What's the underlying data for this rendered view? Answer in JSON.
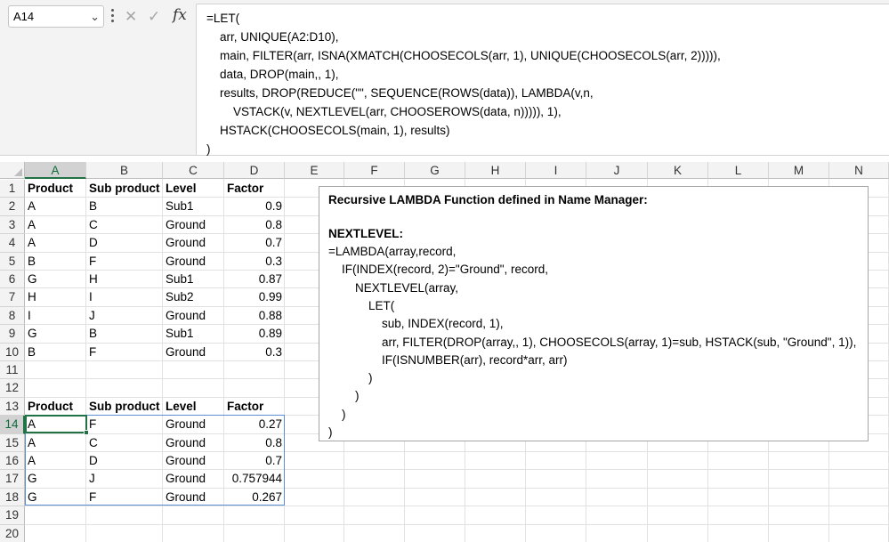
{
  "name_box": {
    "value": "A14"
  },
  "formula_bar": {
    "icons": [
      "cancel-icon",
      "enter-icon",
      "fx-icon"
    ],
    "fx_label": "fx",
    "lines": [
      "=LET(",
      "    arr, UNIQUE(A2:D10),",
      "    main, FILTER(arr, ISNA(XMATCH(CHOOSECOLS(arr, 1), UNIQUE(CHOOSECOLS(arr, 2))))),",
      "    data, DROP(main,, 1),",
      "    results, DROP(REDUCE(\"\", SEQUENCE(ROWS(data)), LAMBDA(v,n,",
      "        VSTACK(v, NEXTLEVEL(arr, CHOOSEROWS(data, n))))), 1),",
      "    HSTACK(CHOOSECOLS(main, 1), results)",
      ")"
    ]
  },
  "columns": [
    "A",
    "B",
    "C",
    "D",
    "E",
    "F",
    "G",
    "H",
    "I",
    "J",
    "K",
    "L",
    "M",
    "N"
  ],
  "selected_column": "A",
  "rows": [
    "1",
    "2",
    "3",
    "4",
    "5",
    "6",
    "7",
    "8",
    "9",
    "10",
    "11",
    "12",
    "13",
    "14",
    "15",
    "16",
    "17",
    "18",
    "19",
    "20"
  ],
  "selected_row": "14",
  "table1": {
    "headers": [
      "Product",
      "Sub product",
      "Level",
      "Factor"
    ],
    "rows": [
      [
        "A",
        "B",
        "Sub1",
        "0.9"
      ],
      [
        "A",
        "C",
        "Ground",
        "0.8"
      ],
      [
        "A",
        "D",
        "Ground",
        "0.7"
      ],
      [
        "B",
        "F",
        "Ground",
        "0.3"
      ],
      [
        "G",
        "H",
        "Sub1",
        "0.87"
      ],
      [
        "H",
        "I",
        "Sub2",
        "0.99"
      ],
      [
        "I",
        "J",
        "Ground",
        "0.88"
      ],
      [
        "G",
        "B",
        "Sub1",
        "0.89"
      ],
      [
        "B",
        "F",
        "Ground",
        "0.3"
      ]
    ]
  },
  "table2": {
    "headers": [
      "Product",
      "Sub product",
      "Level",
      "Factor"
    ],
    "rows": [
      [
        "A",
        "F",
        "Ground",
        "0.27"
      ],
      [
        "A",
        "C",
        "Ground",
        "0.8"
      ],
      [
        "A",
        "D",
        "Ground",
        "0.7"
      ],
      [
        "G",
        "J",
        "Ground",
        "0.757944"
      ],
      [
        "G",
        "F",
        "Ground",
        "0.267"
      ]
    ]
  },
  "textbox": {
    "title": "Recursive LAMBDA Function defined in Name Manager:",
    "name": "NEXTLEVEL:",
    "lines": [
      "=LAMBDA(array,record,",
      "    IF(INDEX(record, 2)=\"Ground\", record,",
      "        NEXTLEVEL(array,",
      "            LET(",
      "                sub, INDEX(record, 1),",
      "                arr, FILTER(DROP(array,, 1), CHOOSECOLS(array, 1)=sub, HSTACK(sub, \"Ground\", 1)),",
      "                IF(ISNUMBER(arr), record*arr, arr)",
      "            )",
      "        )",
      "    )",
      ")"
    ]
  },
  "colors": {
    "selection": "#217346",
    "spill_border": "#5b8fd6",
    "header_bg": "#f3f3f3",
    "gridline": "#e1e1e1"
  }
}
